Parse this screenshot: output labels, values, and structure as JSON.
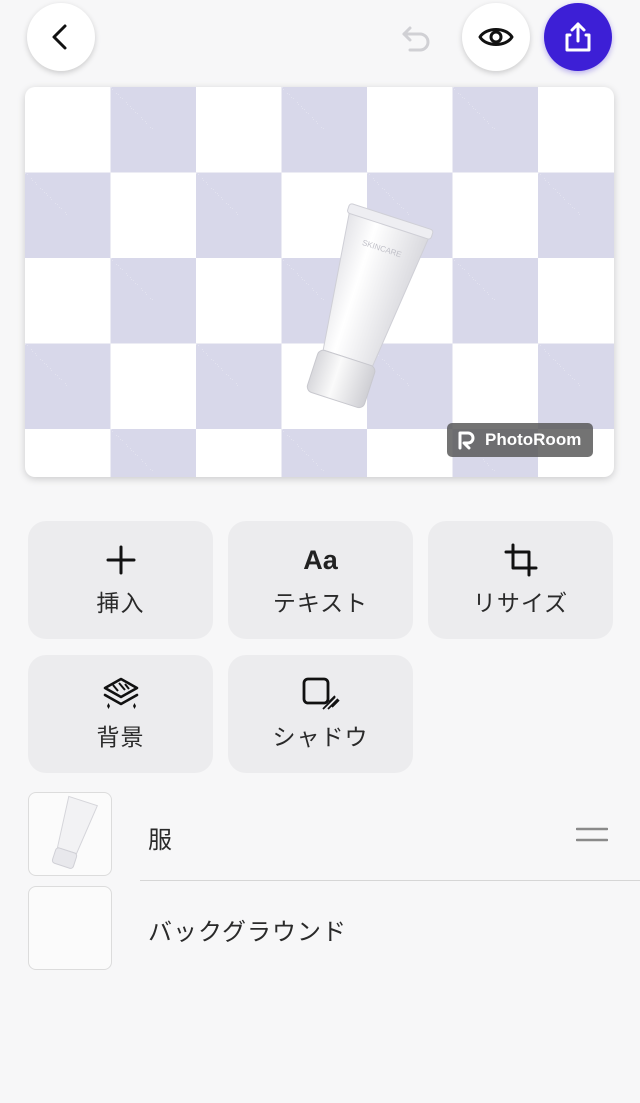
{
  "header": {
    "back_icon": "chevron-left-icon",
    "undo_icon": "undo-icon",
    "preview_icon": "eye-icon",
    "share_icon": "share-icon",
    "accent_color": "#3d1fd6"
  },
  "canvas": {
    "background": "checkerboard",
    "product_label": "SKINCARE",
    "watermark": "PhotoRoom"
  },
  "tools": [
    {
      "icon": "plus-icon",
      "label": "挿入"
    },
    {
      "icon": "aa-text-icon",
      "glyph": "Aa",
      "label": "テキスト"
    },
    {
      "icon": "crop-icon",
      "label": "リサイズ"
    },
    {
      "icon": "layers-icon",
      "label": "背景"
    },
    {
      "icon": "shadow-icon",
      "label": "シャドウ"
    }
  ],
  "layers": [
    {
      "label": "服",
      "icon": "drag-handle-icon"
    },
    {
      "label": "バックグラウンド"
    }
  ]
}
